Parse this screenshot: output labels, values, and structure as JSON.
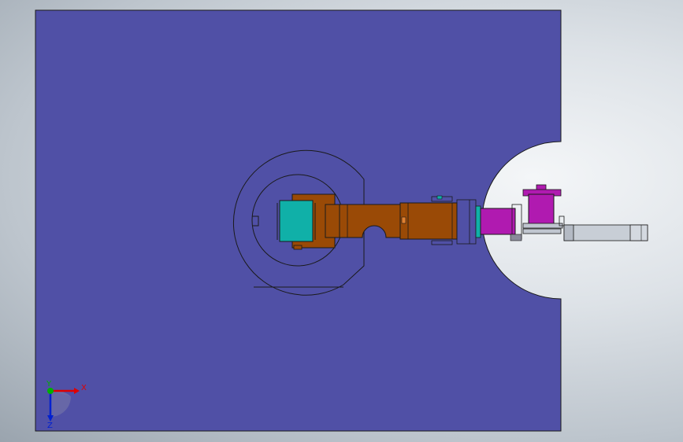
{
  "viewport": {
    "background_top": "#f4f6f8",
    "background_bottom": "#9aa4ae"
  },
  "model": {
    "plate_color": "#5050a6",
    "outline_color": "#1a1a1a",
    "gripper_body_color": "#10b0a8",
    "arm_color": "#9a4a06",
    "motor_color": "#b01ab0",
    "grey_part_color": "#c0c6d0"
  },
  "triad": {
    "x_label": "X",
    "y_label": "Y",
    "z_label": "Z",
    "x_color": "#e00000",
    "y_color": "#00b000",
    "z_color": "#0020d0"
  }
}
